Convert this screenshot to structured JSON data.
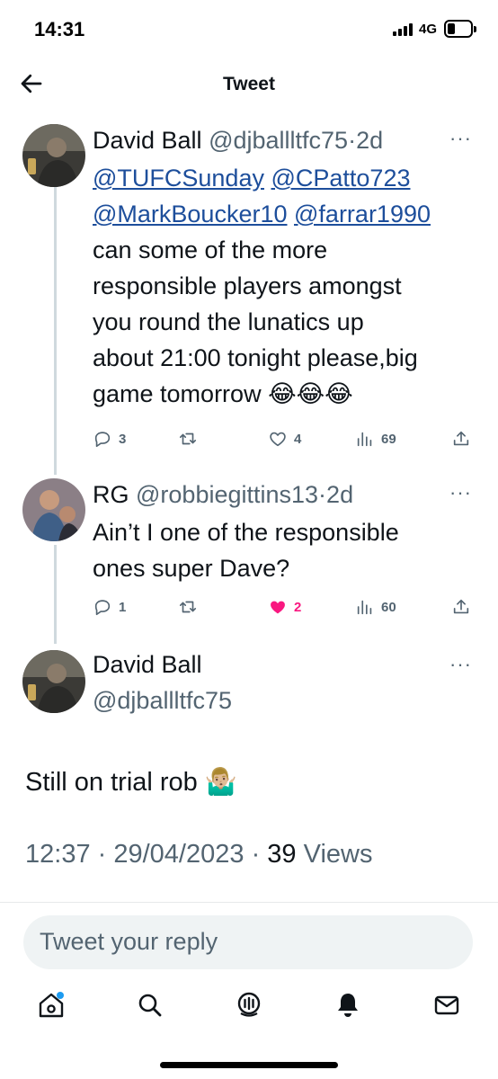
{
  "status_bar": {
    "time": "14:31",
    "network": "4G"
  },
  "nav": {
    "title": "Tweet"
  },
  "thread": [
    {
      "name": "David Ball",
      "handle": "@djballltfc75",
      "dot": "·",
      "age": "2d",
      "mentions": [
        "@TUFCSunday",
        "@CPatto723",
        "@MarkBoucker10",
        "@farrar1990"
      ],
      "body_lines": [
        "can some of the more",
        "responsible players amongst",
        "you round the lunatics up",
        "about 21:00 tonight please,big",
        "game tomorrow 😂😂😂"
      ],
      "stats": {
        "replies": "3",
        "retweets": "",
        "likes": "4",
        "views": "69"
      }
    },
    {
      "name": "RG",
      "handle": "@robbiegittins13",
      "dot": "·",
      "age": "2d",
      "body_lines": [
        "Ain’t I one of the responsible",
        "ones super Dave?"
      ],
      "stats": {
        "replies": "1",
        "retweets": "",
        "likes": "2",
        "views": "60"
      }
    }
  ],
  "main_tweet": {
    "name": "David Ball",
    "handle": "@djballltfc75",
    "text": "Still on trial rob 🤷🏼‍♂️",
    "time": "12:37",
    "date": "29/04/2023",
    "views_count": "39",
    "views_label": "Views"
  },
  "reply": {
    "placeholder": "Tweet your reply"
  },
  "more_label": "···",
  "colors": {
    "link": "#1d4e9b",
    "like": "#f91880",
    "secondary": "#536471",
    "notification_dot": "#1d9bf0"
  },
  "icons": [
    "back-arrow-icon",
    "more-icon",
    "reply-icon",
    "retweet-icon",
    "like-icon",
    "views-icon",
    "share-icon",
    "home-icon",
    "search-icon",
    "spaces-icon",
    "notifications-icon",
    "messages-icon"
  ]
}
